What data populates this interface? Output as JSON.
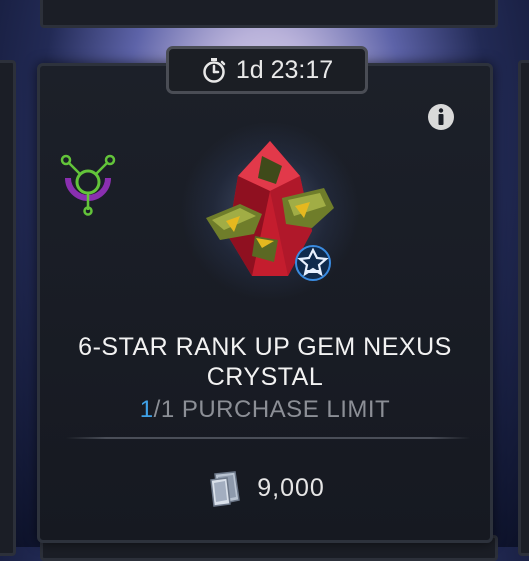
{
  "timer": {
    "text": "1d 23:17",
    "icon": "stopwatch-icon"
  },
  "offer": {
    "title": "6-STAR RANK UP GEM NEXUS CRYSTAL",
    "limit_count": "1",
    "limit_rest": "/1 PURCHASE LIMIT",
    "price": "9,000",
    "currency_icon": "units-icon",
    "item_icon": "nexus-crystal-icon",
    "class_icon": "class-badge-icon",
    "nexus_icon": "nexus-symbol-icon",
    "info_icon": "info-icon"
  },
  "colors": {
    "card_bg": "#1b1e26",
    "limit_accent": "#3fa2e8",
    "crystal_red": "#c41d2e",
    "crystal_green": "#6f7d2a",
    "nexus_purple": "#8a2fb0",
    "nexus_green": "#63c43a"
  }
}
